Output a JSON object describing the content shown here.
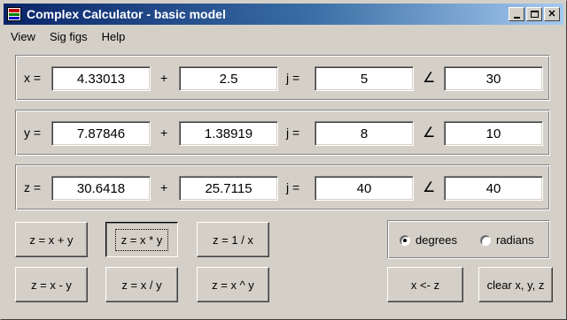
{
  "window": {
    "title": "Complex Calculator - basic model",
    "minimize": "_",
    "close": "✕"
  },
  "menu": [
    "View",
    "Sig figs",
    "Help"
  ],
  "rows": [
    {
      "var": "x =",
      "re": "4.33013",
      "im": "2.5",
      "mag": "5",
      "ang": "30"
    },
    {
      "var": "y =",
      "re": "7.87846",
      "im": "1.38919",
      "mag": "8",
      "ang": "10"
    },
    {
      "var": "z =",
      "re": "30.6418",
      "im": "25.7115",
      "mag": "40",
      "ang": "40"
    }
  ],
  "symbols": {
    "plus": "+",
    "j": "j =",
    "angle": "∠"
  },
  "ops": {
    "add": "z = x + y",
    "mul": "z = x * y",
    "inv": "z = 1 / x",
    "sub": "z = x - y",
    "div": "z = x / y",
    "pow": "z = x ^ y"
  },
  "units": {
    "degrees": "degrees",
    "radians": "radians",
    "selected": "degrees"
  },
  "actions": {
    "copy": "x <- z",
    "clear": "clear x, y, z"
  }
}
